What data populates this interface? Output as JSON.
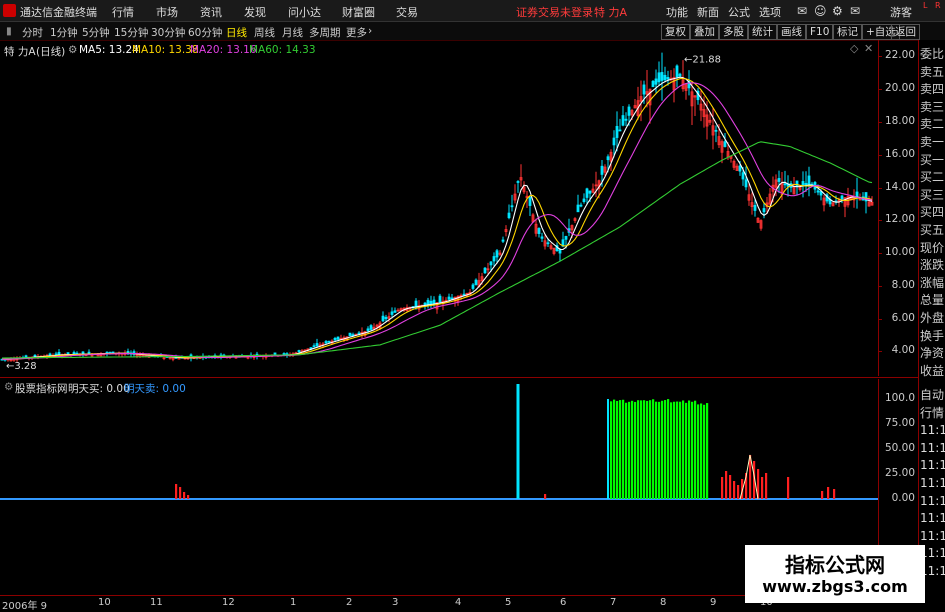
{
  "menubar": {
    "app_title": "通达信金融终端",
    "items": [
      "行情",
      "市场",
      "资讯",
      "发现",
      "问小达",
      "财富圈",
      "交易"
    ],
    "notice": "证券交易未登录",
    "stock_name": "特 力A",
    "right_items": [
      "功能",
      "新面",
      "公式",
      "选项"
    ],
    "user": "游客",
    "corner_l": "L",
    "corner_r": "R"
  },
  "toolbar": {
    "periods": [
      "分时",
      "1分钟",
      "5分钟",
      "15分钟",
      "30分钟",
      "60分钟",
      "日线",
      "周线",
      "月线",
      "多周期",
      "更多"
    ],
    "active_period": "日线",
    "right_buttons": [
      "复权",
      "叠加",
      "多股",
      "统计",
      "画线",
      "F10",
      "标记",
      "+自选",
      "返回"
    ]
  },
  "legend": {
    "title": "特 力A",
    "period": "(日线)",
    "ma5": "MA5: 13.24",
    "ma10": "MA10: 13.38",
    "ma20": "MA20: 13.16",
    "ma60": "MA60: 14.33"
  },
  "sub_legend": {
    "title": "股票指标网",
    "buy": "明天买: 0.00",
    "sell": "明天卖: 0.00"
  },
  "colors": {
    "ma5": "#ffffff",
    "ma10": "#ffd700",
    "ma20": "#e040e0",
    "ma60": "#33cc33",
    "up": "#ff3333",
    "down": "#00e5ff",
    "buy_bar": "#00ff00",
    "sell_bar": "#ff2020",
    "baseline": "#3399ff"
  },
  "price_axis": [
    "22.00",
    "20.00",
    "18.00",
    "16.00",
    "14.00",
    "12.00",
    "10.00",
    "8.00",
    "6.00",
    "4.00"
  ],
  "sub_axis": [
    "100.0",
    "75.00",
    "50.00",
    "25.00",
    "0.00"
  ],
  "annotations": {
    "high": "21.88",
    "low": "3.28"
  },
  "right_panel": [
    "委比",
    "卖五",
    "卖四",
    "卖三",
    "卖二",
    "卖一",
    "买一",
    "买二",
    "买三",
    "买四",
    "买五",
    "现价",
    "涨跌",
    "涨幅",
    "总量",
    "外盘",
    "换手",
    "净资",
    "收益",
    "自动",
    "行情",
    "11:1",
    "11:1",
    "11:1",
    "11:1",
    "11:1",
    "11:1",
    "11:1",
    "11:1",
    "11:1"
  ],
  "date_axis": [
    "2006年 9",
    "10",
    "11",
    "12",
    "1",
    "2",
    "3",
    "4",
    "5",
    "6",
    "7",
    "8",
    "9",
    "10"
  ],
  "watermark": {
    "line1": "指标公式网",
    "line2": "www.zbgs3.com"
  },
  "chart_data": {
    "type": "candlestick",
    "price_range": [
      2.5,
      23
    ],
    "indicator_range": [
      -50,
      120
    ],
    "close_anchors": [
      [
        0,
        3.5
      ],
      [
        60,
        3.8
      ],
      [
        120,
        3.9
      ],
      [
        180,
        3.6
      ],
      [
        240,
        3.7
      ],
      [
        290,
        3.8
      ],
      [
        330,
        4.6
      ],
      [
        370,
        5.3
      ],
      [
        400,
        6.6
      ],
      [
        440,
        7.0
      ],
      [
        470,
        7.6
      ],
      [
        500,
        10.0
      ],
      [
        520,
        14.8
      ],
      [
        540,
        11.0
      ],
      [
        560,
        10.0
      ],
      [
        580,
        12.8
      ],
      [
        600,
        14.5
      ],
      [
        620,
        17.5
      ],
      [
        640,
        19.5
      ],
      [
        660,
        20.5
      ],
      [
        680,
        20.8
      ],
      [
        700,
        19.2
      ],
      [
        720,
        17.0
      ],
      [
        740,
        15.0
      ],
      [
        760,
        11.8
      ],
      [
        775,
        14.5
      ],
      [
        790,
        14.0
      ],
      [
        810,
        14.2
      ],
      [
        830,
        13.0
      ],
      [
        850,
        13.5
      ],
      [
        870,
        13.1
      ]
    ],
    "ma60_anchors": [
      [
        0,
        3.6
      ],
      [
        200,
        3.7
      ],
      [
        300,
        3.8
      ],
      [
        380,
        4.4
      ],
      [
        440,
        5.6
      ],
      [
        500,
        7.6
      ],
      [
        560,
        9.5
      ],
      [
        620,
        11.6
      ],
      [
        680,
        14.2
      ],
      [
        720,
        15.6
      ],
      [
        760,
        16.8
      ],
      [
        790,
        16.5
      ],
      [
        830,
        15.5
      ],
      [
        870,
        14.3
      ]
    ],
    "buy_signals": [
      [
        518,
        115
      ]
    ],
    "buy_block": {
      "start": 610,
      "end": 707,
      "level": 100
    },
    "sell_signals": [
      [
        176,
        15
      ],
      [
        180,
        12
      ],
      [
        184,
        7
      ],
      [
        188,
        4
      ],
      [
        545,
        5
      ],
      [
        722,
        22
      ],
      [
        726,
        28
      ],
      [
        730,
        24
      ],
      [
        734,
        18
      ],
      [
        738,
        14
      ],
      [
        742,
        20
      ],
      [
        746,
        26
      ],
      [
        750,
        44
      ],
      [
        754,
        38
      ],
      [
        758,
        30
      ],
      [
        762,
        22
      ],
      [
        766,
        26
      ],
      [
        788,
        22
      ],
      [
        822,
        8
      ],
      [
        828,
        12
      ],
      [
        834,
        10
      ]
    ]
  }
}
